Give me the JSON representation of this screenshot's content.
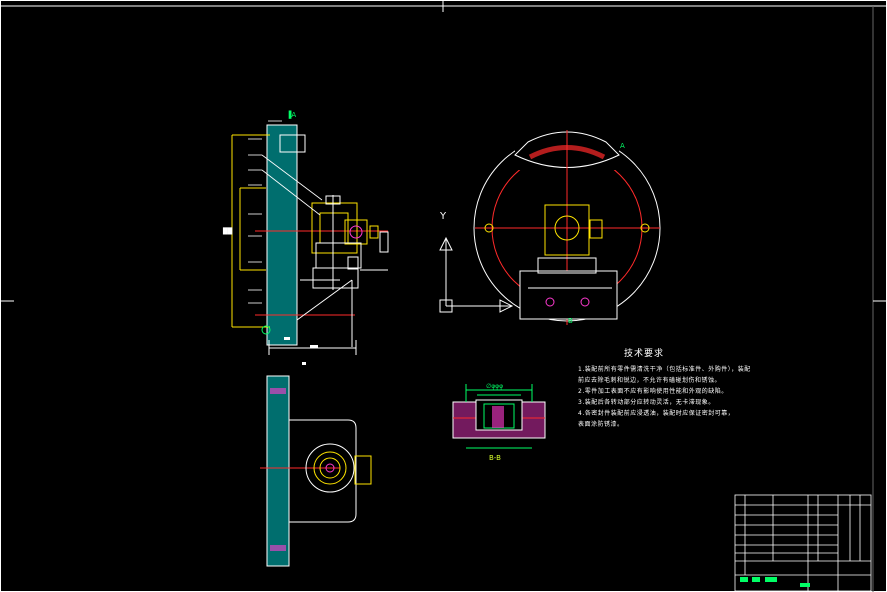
{
  "viewport": {
    "width": 887,
    "height": 592,
    "background": "#000000"
  },
  "drawing": {
    "technical_requirements": {
      "title": "技术要求",
      "lines": [
        "1.装配前所有零件需清洗干净（包括标准件、外购件），装配",
        "前应去除毛刺和锐边，不允许有磕碰划伤和锈蚀。",
        "2.零件加工表面不应有影响使用性能和外观的缺陷。",
        "3.装配后各转动部分应转动灵活，无卡滞现象。",
        "4.各密封件装配前应浸透油，装配时应保证密封可靠，",
        "表面涂防锈漆。"
      ]
    },
    "section_label": "B-B",
    "dimension_text": "∅φφφ",
    "colors": {
      "outline": "#ffffff",
      "center_line": "#ff2a2a",
      "hatch": "#00c9c9",
      "part": "#ffe500",
      "accent": "#ff3ad1",
      "dimension": "#00ff66"
    },
    "icons": [
      "ucs-axis-icon"
    ]
  }
}
